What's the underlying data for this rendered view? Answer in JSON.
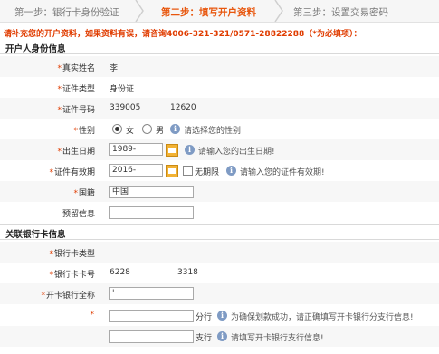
{
  "steps": [
    {
      "label": "第一步：银行卡身份验证",
      "active": false
    },
    {
      "label": "第二步：填写开户资料",
      "active": true
    },
    {
      "label": "第三步：设置交易密码",
      "active": false
    }
  ],
  "notice": "请补充您的开户资料，如果资料有误，请咨询4006-321-321/0571-28822288（*为必填项）：",
  "identity_section": {
    "title": "开户人身份信息",
    "name": {
      "label": "真实姓名",
      "value": "李"
    },
    "id_type": {
      "label": "证件类型",
      "value": "身份证"
    },
    "id_number": {
      "label": "证件号码",
      "value_a": "339005",
      "value_b": "12620"
    },
    "gender": {
      "label": "性别",
      "female": "女",
      "male": "男",
      "selected": "女",
      "hint": "请选择您的性别"
    },
    "birth_date": {
      "label": "出生日期",
      "value": "1989-",
      "hint": "请输入您的出生日期!"
    },
    "id_validity": {
      "label": "证件有效期",
      "value": "2016-",
      "unlimited_label": "无期限",
      "hint": "请输入您的证件有效期!"
    },
    "nationality": {
      "label": "国籍",
      "value": "中国"
    },
    "reserved_info": {
      "label": "预留信息",
      "value": ""
    }
  },
  "bank_section": {
    "title": "关联银行卡信息",
    "card_type": {
      "label": "银行卡类型",
      "value": ""
    },
    "card_number": {
      "label": "银行卡卡号",
      "value_a": "6228",
      "value_b": "3318"
    },
    "bank_name": {
      "label": "开卡银行全称",
      "value": "'"
    },
    "branch": {
      "suffix": "分行",
      "value": "",
      "hint": "为确保划款成功，请正确填写开卡银行分支行信息!"
    },
    "sub_branch": {
      "suffix": "支行",
      "value": "",
      "hint": "请填写开卡银行支行信息!"
    }
  },
  "required_mark": "*",
  "info_icon_glyph": "i",
  "colors": {
    "accent": "#e8570e",
    "required": "#e03c00",
    "info_icon": "#7f9bc4"
  }
}
